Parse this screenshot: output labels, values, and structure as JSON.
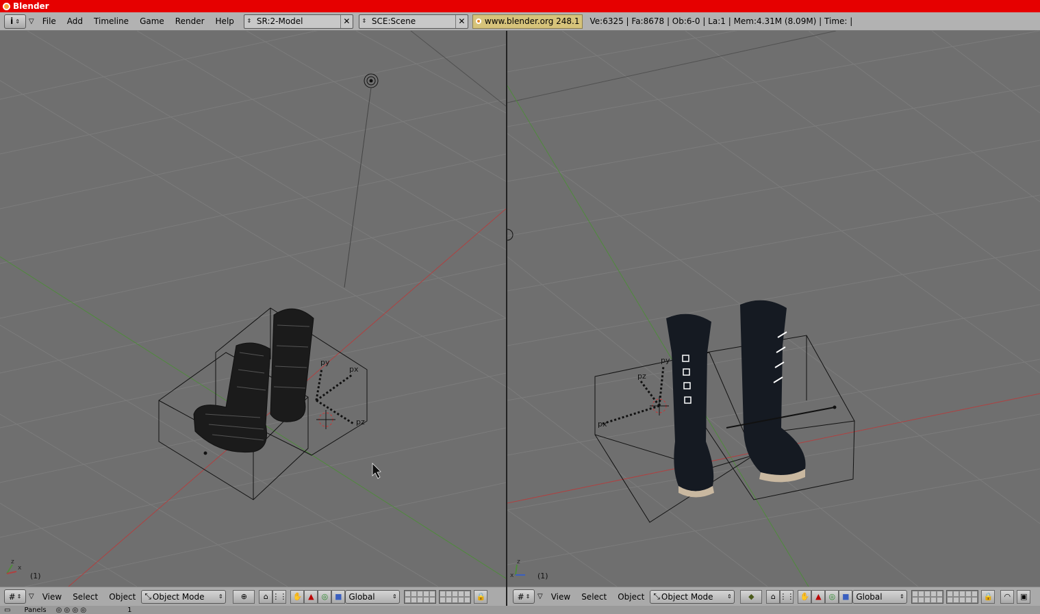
{
  "window": {
    "title": "Blender"
  },
  "topbar": {
    "menu": [
      "File",
      "Add",
      "Timeline",
      "Game",
      "Render",
      "Help"
    ],
    "screen_field": "SR:2-Model",
    "scene_field": "SCE:Scene",
    "link": "www.blender.org 248.1",
    "stats": "Ve:6325 | Fa:8678 | Ob:6-0 | La:1  | Mem:4.31M (8.09M)  | Time: |"
  },
  "viewport_left": {
    "frame": "(1)",
    "labels": {
      "py": "py",
      "px": "px",
      "pz": "pz"
    }
  },
  "viewport_right": {
    "frame": "(1)",
    "labels": {
      "pz": "pz",
      "py": "py",
      "px": "px"
    }
  },
  "view_header_left": {
    "menu": [
      "View",
      "Select",
      "Object"
    ],
    "mode": "Object Mode",
    "orientation": "Global"
  },
  "view_header_right": {
    "menu": [
      "View",
      "Select",
      "Object"
    ],
    "mode": "Object Mode",
    "orientation": "Global"
  },
  "bottom_strip": {
    "label": "Panels",
    "value": "1"
  },
  "colors": {
    "title_bg": "#e60000",
    "viewport_bg": "#6f6f6f",
    "grid": "#7b7b7b",
    "x_axis": "#b04040",
    "y_axis": "#4f8a3c"
  },
  "icons": [
    "info-icon",
    "grid-icon",
    "object-mode-icon",
    "hand-icon",
    "rotate-icon",
    "scale-icon",
    "lock-icon"
  ]
}
